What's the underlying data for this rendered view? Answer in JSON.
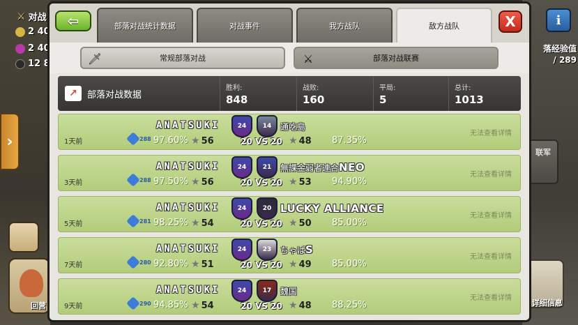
{
  "background": {
    "title": "对战",
    "resources": [
      {
        "value": "2 40",
        "color": "#d6b642"
      },
      {
        "value": "2 40",
        "color": "#b83aa8"
      },
      {
        "value": "12 8",
        "color": "#2a2a2a"
      }
    ],
    "xp_label": "落经验值",
    "xp_value": "289",
    "side_badge": "联军",
    "left_card_label": "回营",
    "right_card_label": "详细信息"
  },
  "header": {
    "back_icon": "back-arrow-icon",
    "tabs": [
      {
        "label": "部落对战统计数据",
        "active": false
      },
      {
        "label": "对战事件",
        "active": false
      },
      {
        "label": "我方战队",
        "active": false
      },
      {
        "label": "敌方战队",
        "active": true
      }
    ],
    "close_label": "X"
  },
  "subtabs": [
    {
      "label": "常规部落对战",
      "icon": "sword-icon",
      "active": false
    },
    {
      "label": "部落对战联赛",
      "icon": "crossed-swords-icon",
      "active": true
    }
  ],
  "stats": {
    "title": "部落对战数据",
    "wins_label": "胜利:",
    "wins": "848",
    "losses_label": "战败:",
    "losses": "160",
    "draws_label": "平局:",
    "draws": "5",
    "total_label": "总计:",
    "total": "1013"
  },
  "wars": [
    {
      "time": "1天前",
      "xp": "288",
      "our_name": "ANATSUKI",
      "our_pct": "97.60%",
      "our_stars": "56",
      "our_level": "24",
      "enemy_level": "14",
      "score": "20 VS 20",
      "enemy_name": "通吃島",
      "enemy_name_bold": "",
      "enemy_stars": "48",
      "enemy_pct": "87.35%",
      "detail": "无法查看详情"
    },
    {
      "time": "3天前",
      "xp": "288",
      "our_name": "ANATSUKI",
      "our_pct": "97.50%",
      "our_stars": "56",
      "our_level": "24",
      "enemy_level": "21",
      "score": "20 VS 20",
      "enemy_name": "無課金弱者連合",
      "enemy_name_bold": "NEO",
      "enemy_stars": "53",
      "enemy_pct": "94.90%",
      "detail": "无法查看详情"
    },
    {
      "time": "5天前",
      "xp": "281",
      "our_name": "ANATSUKI",
      "our_pct": "98.25%",
      "our_stars": "54",
      "our_level": "24",
      "enemy_level": "20",
      "score": "20 VS 20",
      "enemy_name": "",
      "enemy_name_bold": "LUCKY ALLIANCE",
      "enemy_stars": "50",
      "enemy_pct": "85.00%",
      "detail": "无法查看详情"
    },
    {
      "time": "7天前",
      "xp": "280",
      "our_name": "ANATSUKI",
      "our_pct": "92.80%",
      "our_stars": "51",
      "our_level": "24",
      "enemy_level": "23",
      "score": "20 VS 20",
      "enemy_name": "ちゃば",
      "enemy_name_bold": "S",
      "enemy_stars": "49",
      "enemy_pct": "85.00%",
      "detail": "无法查看详情"
    },
    {
      "time": "9天前",
      "xp": "290",
      "our_name": "ANATSUKI",
      "our_pct": "94.85%",
      "our_stars": "54",
      "our_level": "24",
      "enemy_level": "17",
      "score": "20 VS 20",
      "enemy_name": "魏国",
      "enemy_name_bold": "",
      "enemy_stars": "48",
      "enemy_pct": "88.25%",
      "detail": "无法查看详情"
    }
  ]
}
